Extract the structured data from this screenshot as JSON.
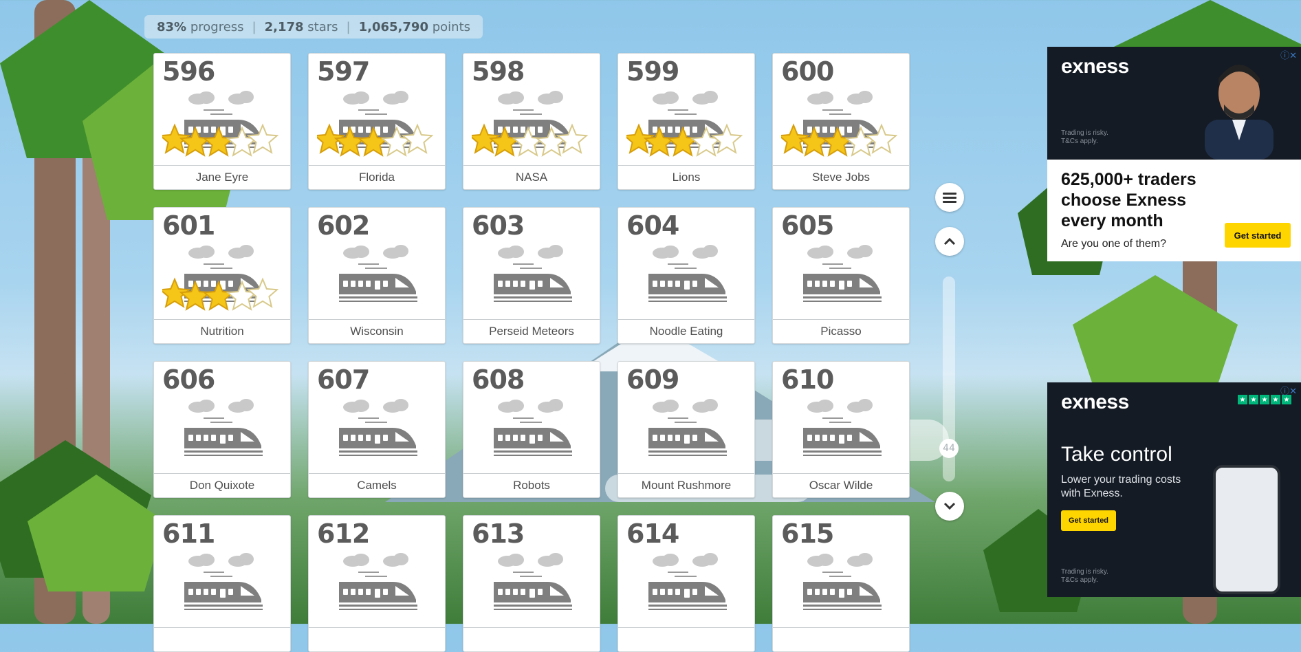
{
  "stats": {
    "progress_value": "83%",
    "progress_label": "progress",
    "stars_value": "2,178",
    "stars_label": "stars",
    "points_value": "1,065,790",
    "points_label": "points"
  },
  "levels": [
    {
      "number": "596",
      "title": "Jane Eyre",
      "stars": 3
    },
    {
      "number": "597",
      "title": "Florida",
      "stars": 3
    },
    {
      "number": "598",
      "title": "NASA",
      "stars": 2
    },
    {
      "number": "599",
      "title": "Lions",
      "stars": 3
    },
    {
      "number": "600",
      "title": "Steve Jobs",
      "stars": 3
    },
    {
      "number": "601",
      "title": "Nutrition",
      "stars": 3
    },
    {
      "number": "602",
      "title": "Wisconsin",
      "stars": 0
    },
    {
      "number": "603",
      "title": "Perseid Meteors",
      "stars": 0
    },
    {
      "number": "604",
      "title": "Noodle Eating",
      "stars": 0
    },
    {
      "number": "605",
      "title": "Picasso",
      "stars": 0
    },
    {
      "number": "606",
      "title": "Don Quixote",
      "stars": 0
    },
    {
      "number": "607",
      "title": "Camels",
      "stars": 0
    },
    {
      "number": "608",
      "title": "Robots",
      "stars": 0
    },
    {
      "number": "609",
      "title": "Mount Rushmore",
      "stars": 0
    },
    {
      "number": "610",
      "title": "Oscar Wilde",
      "stars": 0
    },
    {
      "number": "611",
      "title": "",
      "stars": 0
    },
    {
      "number": "612",
      "title": "",
      "stars": 0
    },
    {
      "number": "613",
      "title": "",
      "stars": 0
    },
    {
      "number": "614",
      "title": "",
      "stars": 0
    },
    {
      "number": "615",
      "title": "",
      "stars": 0
    }
  ],
  "controls": {
    "menu_icon": "hamburger-icon",
    "up_icon": "chevron-up-icon",
    "down_icon": "chevron-down-icon",
    "scroll_page": "44"
  },
  "ads": {
    "ad1": {
      "brand": "exness",
      "fine": "Trading is risky. T&Cs apply.",
      "headline": "625,000+ traders choose Exness every month",
      "sub": "Are you one of them?",
      "cta": "Get started"
    },
    "ad2": {
      "brand": "exness",
      "headline": "Take control",
      "sub": "Lower your trading costs with Exness.",
      "cta": "Get started",
      "fine": "Trading is risky. T&Cs apply."
    }
  },
  "colors": {
    "star_fill": "#f5c518",
    "accent_cta": "#ffd500",
    "trustpilot": "#00b67a"
  }
}
